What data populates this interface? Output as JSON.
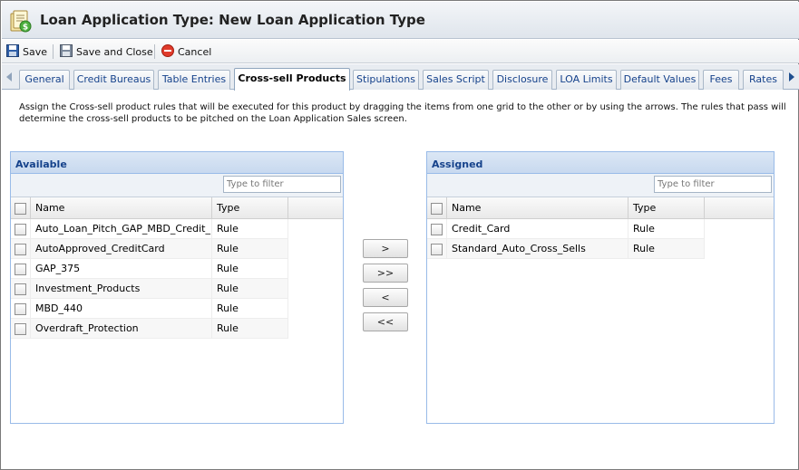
{
  "window": {
    "title": "Loan Application Type: New Loan Application Type"
  },
  "toolbar": {
    "save": "Save",
    "save_close": "Save and Close",
    "cancel": "Cancel"
  },
  "tabs": [
    {
      "label": "General"
    },
    {
      "label": "Credit Bureaus"
    },
    {
      "label": "Table Entries"
    },
    {
      "label": "Cross-sell Products",
      "active": true
    },
    {
      "label": "Stipulations"
    },
    {
      "label": "Sales Script"
    },
    {
      "label": "Disclosure"
    },
    {
      "label": "LOA Limits"
    },
    {
      "label": "Default Values"
    },
    {
      "label": "Fees"
    },
    {
      "label": "Rates"
    }
  ],
  "description": "Assign the Cross-sell product rules that will be executed for this product by dragging the items from one grid to the other or by using the arrows. The rules that pass will determine the cross-sell products to be pitched on the Loan Application Sales screen.",
  "available": {
    "title": "Available",
    "filter_placeholder": "Type to filter",
    "columns": {
      "name": "Name",
      "type": "Type"
    },
    "rows": [
      {
        "name": "Auto_Loan_Pitch_GAP_MBD_Credit_...",
        "type": "Rule"
      },
      {
        "name": "AutoApproved_CreditCard",
        "type": "Rule"
      },
      {
        "name": "GAP_375",
        "type": "Rule"
      },
      {
        "name": "Investment_Products",
        "type": "Rule"
      },
      {
        "name": "MBD_440",
        "type": "Rule"
      },
      {
        "name": "Overdraft_Protection",
        "type": "Rule"
      }
    ]
  },
  "assigned": {
    "title": "Assigned",
    "filter_placeholder": "Type to filter",
    "columns": {
      "name": "Name",
      "type": "Type"
    },
    "rows": [
      {
        "name": "Credit_Card",
        "type": "Rule"
      },
      {
        "name": "Standard_Auto_Cross_Sells",
        "type": "Rule"
      }
    ]
  },
  "move_buttons": {
    "move_one_right": ">",
    "move_all_right": ">>",
    "move_one_left": "<",
    "move_all_left": "<<"
  },
  "icons": {
    "app": "loan-application-icon",
    "save": "floppy-disk-icon",
    "save_close": "save-close-icon",
    "cancel": "cancel-icon",
    "scroll_left": "arrow-left-icon",
    "scroll_right": "arrow-right-icon"
  },
  "colors": {
    "header_text": "#15428b",
    "panel_border": "#99bbe8",
    "active_tab_bg": "#ffffff"
  }
}
